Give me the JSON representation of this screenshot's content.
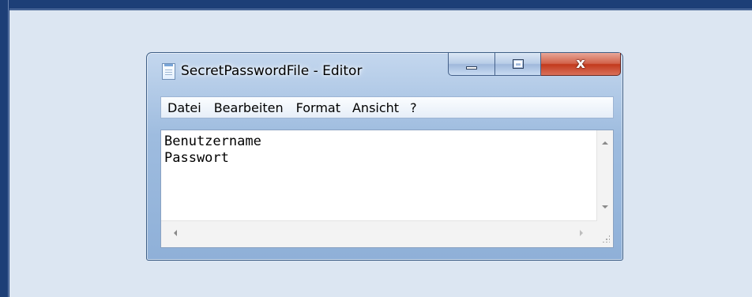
{
  "window": {
    "title": "SecretPasswordFile - Editor",
    "icon": "notepad-icon",
    "caption_buttons": {
      "minimize": "minimize-icon",
      "maximize": "maximize-icon",
      "close": "close-icon",
      "close_glyph": "x"
    }
  },
  "menu": {
    "items": [
      {
        "label": "Datei"
      },
      {
        "label": "Bearbeiten"
      },
      {
        "label": "Format"
      },
      {
        "label": "Ansicht"
      },
      {
        "label": "?"
      }
    ]
  },
  "editor": {
    "lines": [
      "Benutzername",
      "Passwort"
    ]
  },
  "colors": {
    "page_frame": "#1d3f77",
    "content_background": "#dce6f2",
    "close_button": "#c2391c"
  }
}
